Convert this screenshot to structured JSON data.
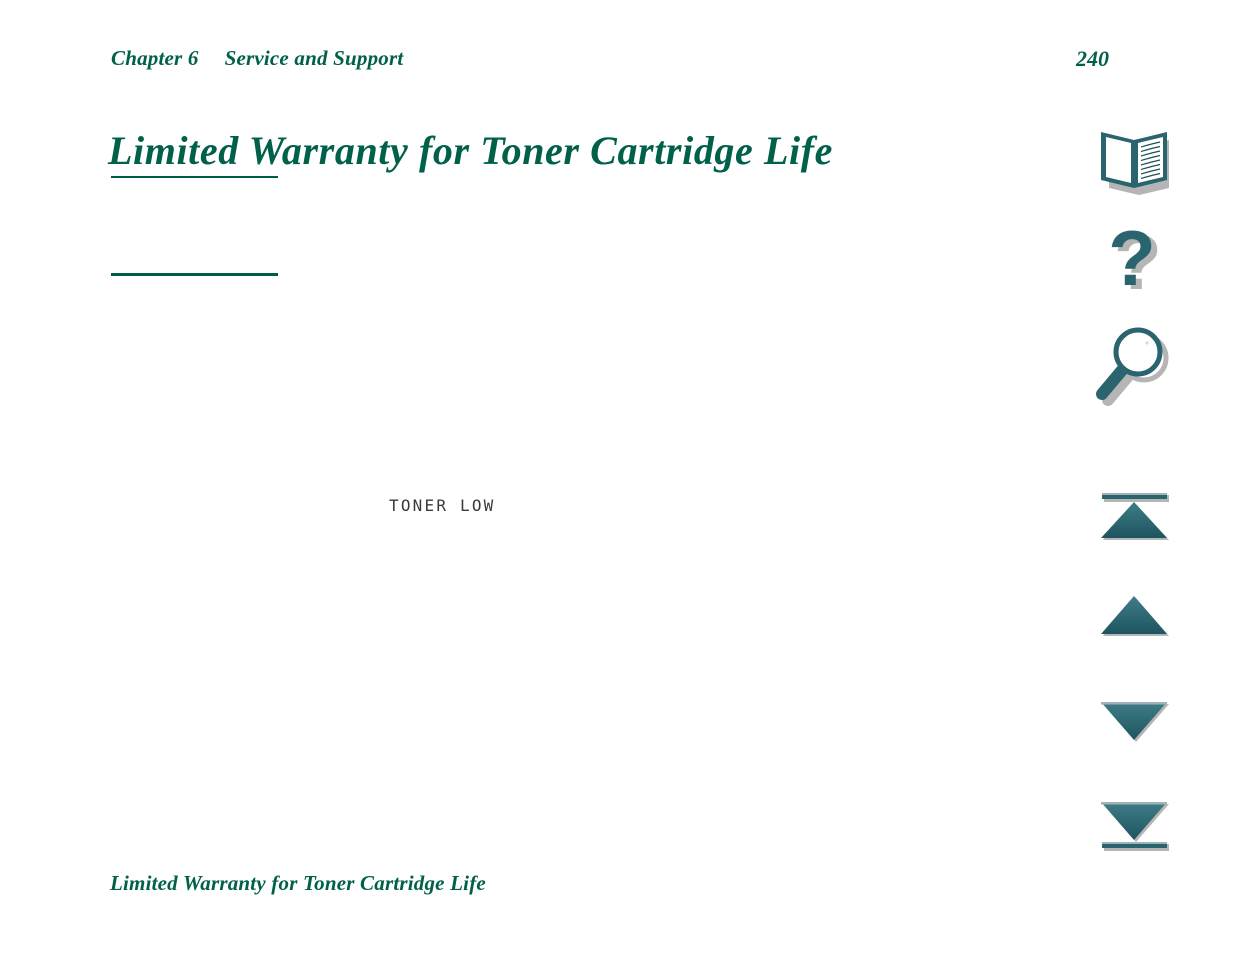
{
  "document": {
    "header": {
      "chapter_label": "Chapter 6",
      "chapter_title": "Service and Support",
      "page_number": "240"
    },
    "title": "Limited Warranty for Toner Cartridge Life",
    "control_panel_message": "TONER LOW",
    "footer": {
      "title": "Limited Warranty for Toner Cartridge Life"
    }
  },
  "nav_sidebar": {
    "buttons": [
      {
        "name": "book-icon",
        "label": "Table of Contents"
      },
      {
        "name": "question-mark-icon",
        "label": "Help"
      },
      {
        "name": "magnifying-glass-icon",
        "label": "Search"
      },
      {
        "name": "first-page-icon",
        "label": "Go to first page"
      },
      {
        "name": "previous-page-icon",
        "label": "Previous page"
      },
      {
        "name": "next-page-icon",
        "label": "Next page"
      },
      {
        "name": "last-page-icon",
        "label": "Go to last page"
      }
    ]
  },
  "colors": {
    "heading_green": "#00604a",
    "rule_green": "#005c46",
    "icon_teal": "#2a646e",
    "icon_teal_dark": "#1d4f58",
    "icon_shadow": "#b5b5b5",
    "lcd_text": "#3a3a3a",
    "page_background": "#ffffff"
  }
}
